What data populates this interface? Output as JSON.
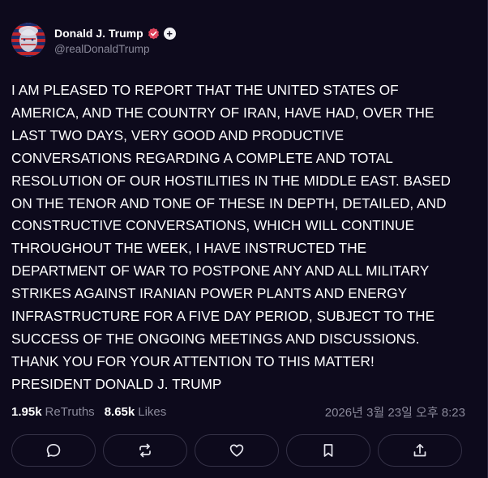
{
  "post": {
    "author": {
      "display_name": "Donald J. Trump",
      "handle": "@realDonaldTrump",
      "verified": true,
      "follow_icon": "plus-icon"
    },
    "body_lines": [
      "I AM PLEASED TO REPORT THAT THE UNITED STATES OF",
      "AMERICA, AND THE COUNTRY OF IRAN, HAVE HAD, OVER THE",
      "LAST TWO DAYS, VERY GOOD AND PRODUCTIVE",
      "CONVERSATIONS REGARDING A COMPLETE AND TOTAL",
      "RESOLUTION OF OUR HOSTILITIES IN THE MIDDLE EAST. BASED",
      "ON THE TENOR AND TONE OF THESE IN DEPTH, DETAILED, AND",
      "CONSTRUCTIVE CONVERSATIONS, WHICH WILL CONTINUE",
      "THROUGHOUT THE WEEK, I HAVE INSTRUCTED THE",
      "DEPARTMENT OF WAR TO POSTPONE ANY AND ALL MILITARY",
      "STRIKES AGAINST IRANIAN POWER PLANTS AND ENERGY",
      "INFRASTRUCTURE FOR A FIVE DAY PERIOD, SUBJECT TO THE",
      "SUCCESS OF THE ONGOING MEETINGS AND DISCUSSIONS.",
      "THANK YOU FOR YOUR ATTENTION TO THIS MATTER!",
      "PRESIDENT DONALD J. TRUMP"
    ],
    "stats": {
      "retruths_count": "1.95k",
      "retruths_label": "ReTruths",
      "likes_count": "8.65k",
      "likes_label": "Likes"
    },
    "timestamp": "2026년 3월 23일 오후 8:23",
    "actions": [
      {
        "name": "reply-button",
        "icon": "speech-bubble-icon"
      },
      {
        "name": "retruth-button",
        "icon": "repost-arrows-icon"
      },
      {
        "name": "like-button",
        "icon": "heart-icon"
      },
      {
        "name": "bookmark-button",
        "icon": "bookmark-icon"
      },
      {
        "name": "share-button",
        "icon": "share-upload-icon"
      }
    ]
  },
  "colors": {
    "background": "#0d0a1c",
    "text_primary": "#ffffff",
    "text_secondary": "#8b8a9b",
    "verified_badge": "#e0455d",
    "button_border": "#353247"
  }
}
